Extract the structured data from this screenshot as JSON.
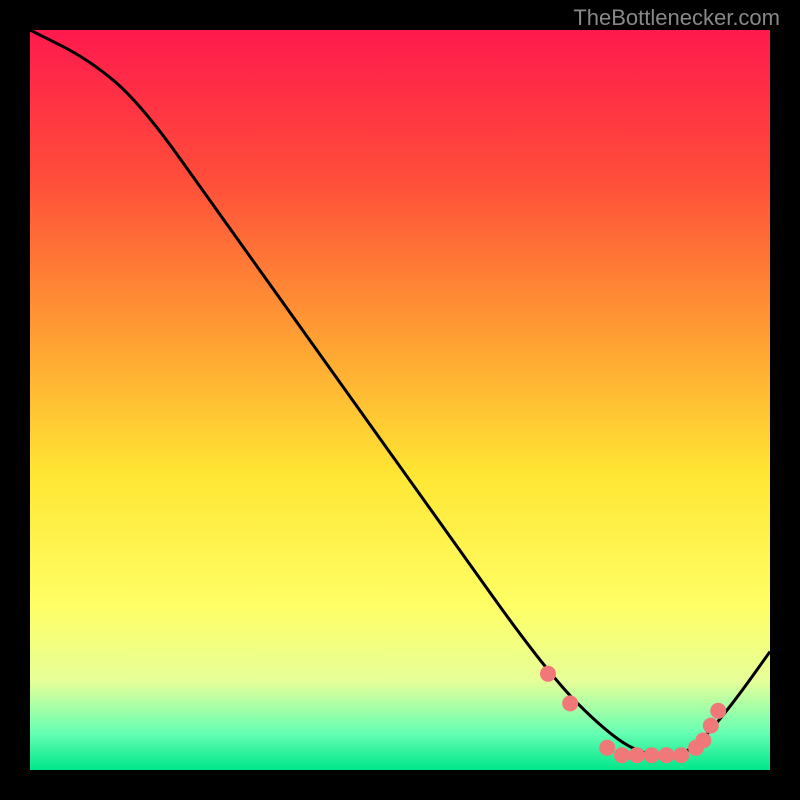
{
  "watermark": "TheBottlenecker.com",
  "chart_data": {
    "type": "line",
    "title": "",
    "xlabel": "",
    "ylabel": "",
    "xlim": [
      0,
      100
    ],
    "ylim": [
      0,
      100
    ],
    "series": [
      {
        "name": "curve",
        "x": [
          0,
          8,
          15,
          25,
          40,
          55,
          70,
          78,
          83,
          87,
          90,
          95,
          100
        ],
        "y": [
          100,
          96,
          90,
          76,
          55,
          34,
          13,
          5,
          2,
          2,
          3,
          9,
          16
        ]
      }
    ],
    "markers": {
      "name": "dots",
      "x": [
        70,
        73,
        78,
        80,
        82,
        84,
        86,
        88,
        90,
        91,
        92,
        93
      ],
      "y": [
        13,
        9,
        3,
        2,
        2,
        2,
        2,
        2,
        3,
        4,
        6,
        8
      ]
    },
    "background": {
      "type": "vertical-gradient",
      "stops": [
        {
          "offset": 0,
          "color": "#ff1a4d"
        },
        {
          "offset": 20,
          "color": "#ff4d3a"
        },
        {
          "offset": 40,
          "color": "#ff9933"
        },
        {
          "offset": 60,
          "color": "#ffe633"
        },
        {
          "offset": 78,
          "color": "#ffff66"
        },
        {
          "offset": 88,
          "color": "#e6ff99"
        },
        {
          "offset": 95,
          "color": "#66ffb3"
        },
        {
          "offset": 100,
          "color": "#00e68a"
        }
      ]
    },
    "marker_color": "#f07878",
    "line_color": "#000000"
  }
}
